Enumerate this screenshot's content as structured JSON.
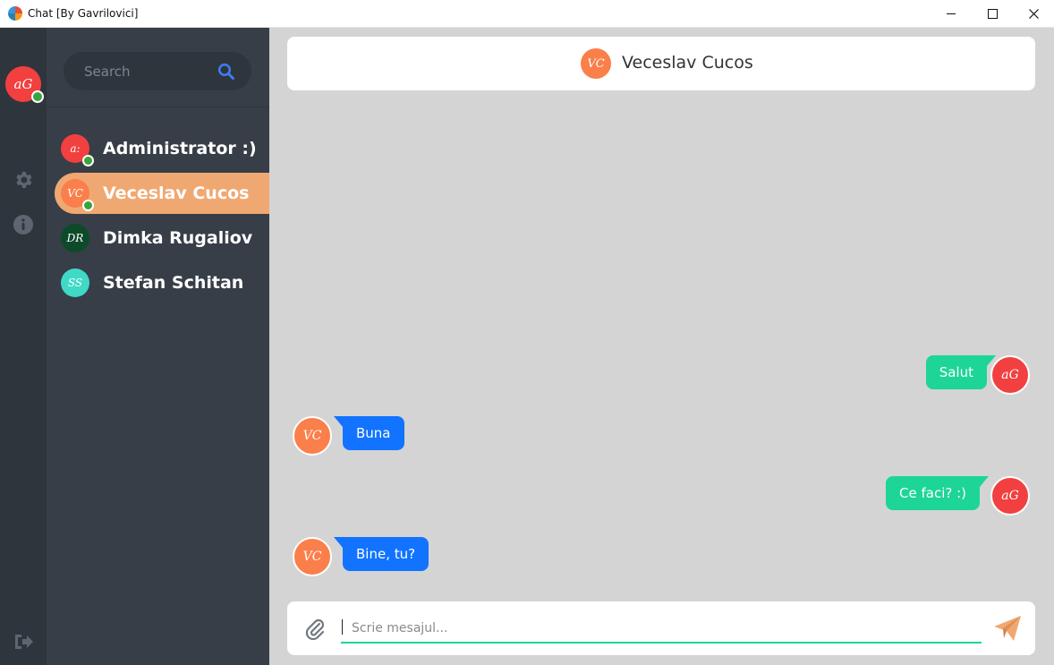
{
  "window": {
    "title": "Chat [By Gavrilovici]"
  },
  "rail": {
    "user_initials": "aG",
    "user_color": "#f1403f",
    "icons": [
      "gear-icon",
      "info-icon",
      "logout-icon"
    ]
  },
  "search": {
    "placeholder": "Search"
  },
  "contacts": [
    {
      "initials": "a:",
      "name": "Administrator :)",
      "color": "#f1403f",
      "online": true,
      "active": false
    },
    {
      "initials": "VC",
      "name": "Veceslav Cucos",
      "color": "#fa7f4a",
      "online": true,
      "active": true
    },
    {
      "initials": "DR",
      "name": "Dimka Rugaliov",
      "color": "#0d4a2a",
      "online": false,
      "active": false
    },
    {
      "initials": "SS",
      "name": "Stefan Schitan",
      "color": "#3fd9c6",
      "online": false,
      "active": false
    }
  ],
  "chat": {
    "header_name": "Veceslav Cucos",
    "header_initials": "VC",
    "messages": [
      {
        "direction": "out",
        "text": "Salut",
        "initials": "aG"
      },
      {
        "direction": "in",
        "text": "Buna",
        "initials": "VC"
      },
      {
        "direction": "out",
        "text": "Ce faci? :)",
        "initials": "aG"
      },
      {
        "direction": "in",
        "text": "Bine, tu?",
        "initials": "VC"
      }
    ]
  },
  "composer": {
    "placeholder": "Scrie mesajul..."
  },
  "colors": {
    "rail_bg": "#2f353c",
    "sidebar_bg": "#373e47",
    "active_contact": "#f0a872",
    "outgoing_bubble": "#1dd597",
    "incoming_bubble": "#1173ff",
    "chat_bg": "#d4d4d4",
    "online": "#3aa33f"
  }
}
